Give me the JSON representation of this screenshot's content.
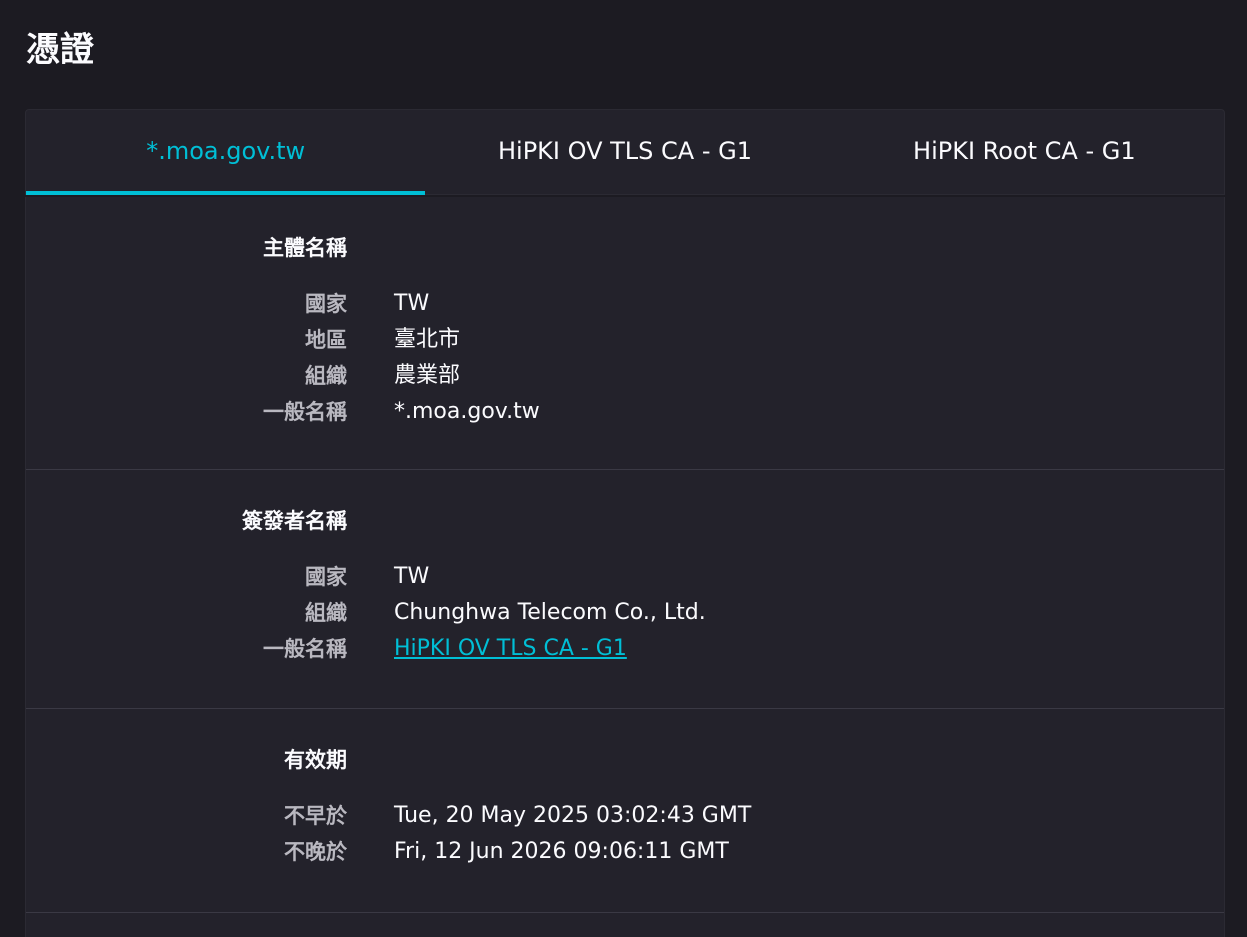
{
  "page": {
    "title": "憑證"
  },
  "tabs": [
    {
      "label": "*.moa.gov.tw",
      "active": true
    },
    {
      "label": "HiPKI OV TLS CA - G1",
      "active": false
    },
    {
      "label": "HiPKI Root CA - G1",
      "active": false
    }
  ],
  "subject": {
    "title": "主體名稱",
    "rows": [
      {
        "label": "國家",
        "value": "TW"
      },
      {
        "label": "地區",
        "value": "臺北市"
      },
      {
        "label": "組織",
        "value": "農業部"
      },
      {
        "label": "一般名稱",
        "value": "*.moa.gov.tw"
      }
    ]
  },
  "issuer": {
    "title": "簽發者名稱",
    "rows": [
      {
        "label": "國家",
        "value": "TW"
      },
      {
        "label": "組織",
        "value": "Chunghwa Telecom Co., Ltd."
      },
      {
        "label": "一般名稱",
        "value": "HiPKI OV TLS CA - G1"
      }
    ]
  },
  "validity": {
    "title": "有效期",
    "rows": [
      {
        "label": "不早於",
        "value": "Tue, 20 May 2025 03:02:43 GMT"
      },
      {
        "label": "不晚於",
        "value": "Fri, 12 Jun 2026 09:06:11 GMT"
      }
    ]
  },
  "colors": {
    "background": "#1c1b22",
    "panel": "#23222b",
    "accent": "#00bfd6",
    "text": "#fbfbfe",
    "label": "#b9b8c0"
  }
}
